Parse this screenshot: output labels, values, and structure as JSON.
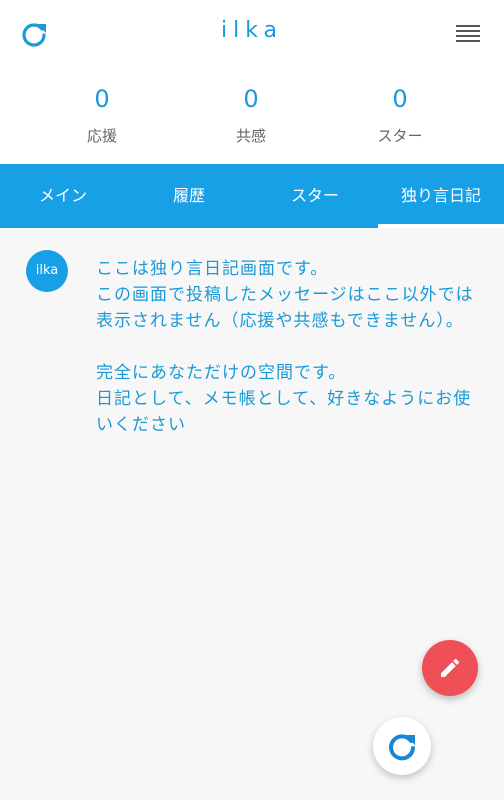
{
  "header": {
    "title": "ilka"
  },
  "stats": [
    {
      "value": "0",
      "label": "応援"
    },
    {
      "value": "0",
      "label": "共感"
    },
    {
      "value": "0",
      "label": "スター"
    }
  ],
  "tabs": [
    {
      "label": "メイン",
      "active": false
    },
    {
      "label": "履歴",
      "active": false
    },
    {
      "label": "スター",
      "active": false
    },
    {
      "label": "独り言日記",
      "active": true
    }
  ],
  "post": {
    "avatar_text": "ilka",
    "lines": [
      "ここは独り言日記画面です。",
      "この画面で投稿したメッセージはここ以外では表示されません（応援や共感もできません）。",
      "完全にあなただけの空間です。",
      "日記として、メモ帳として、好きなようにお使いください"
    ]
  },
  "colors": {
    "accent": "#1a9ad6",
    "tab_bar": "#18a0e6",
    "fab_edit": "#ef4f56"
  },
  "icons": {
    "header_left": "refresh-icon",
    "header_right": "menu-icon",
    "fab_primary": "pencil-icon",
    "fab_secondary": "reload-icon"
  }
}
